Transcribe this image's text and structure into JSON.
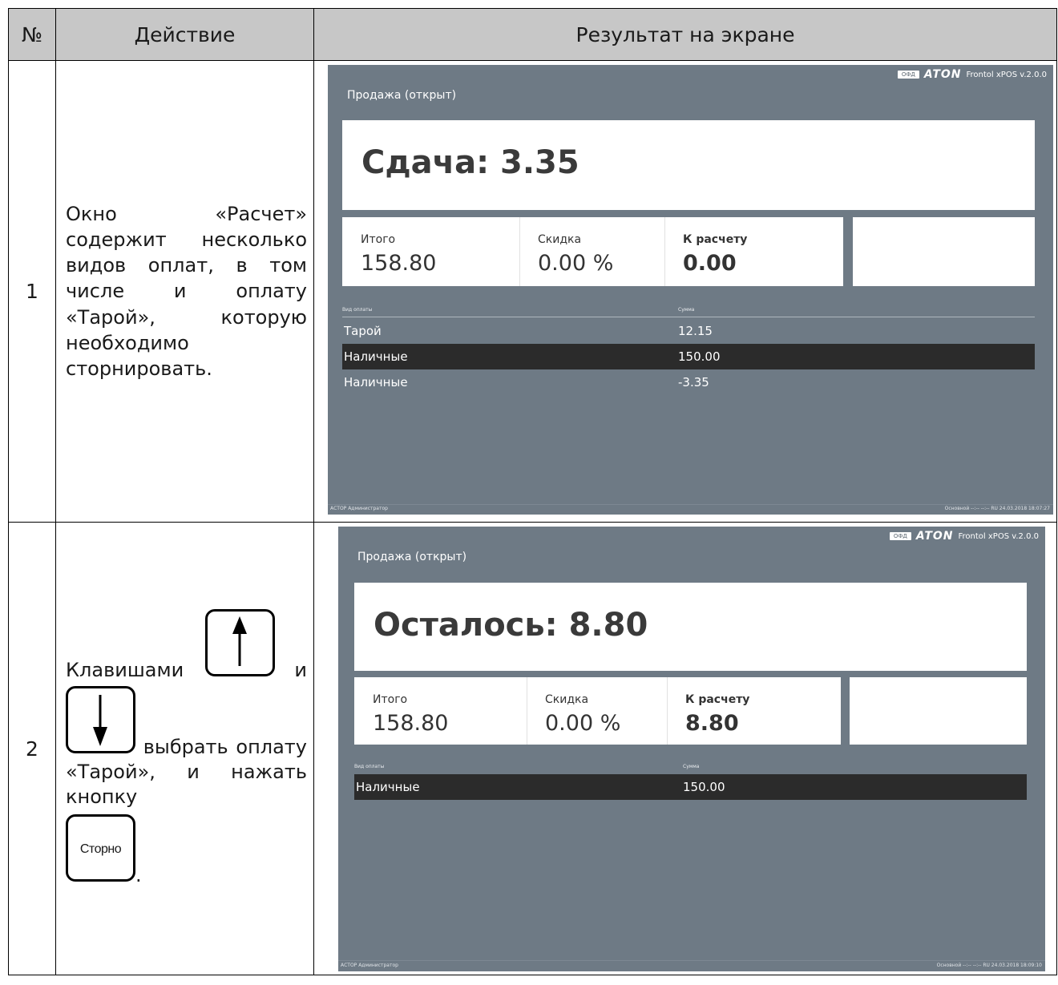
{
  "table": {
    "headers": [
      "№",
      "Действие",
      "Результат на экране"
    ],
    "rows": [
      {
        "num": "1",
        "action": "Окно «Расчет» содержит несколько видов оплат, в том числе и оплату «Тарой», которую необходимо сторнировать."
      },
      {
        "num": "2",
        "action_parts": {
          "p1": "Клавишами",
          "p2": "и",
          "p3": "выбрать оплату «Тарой», и нажать кнопку",
          "p4": "."
        },
        "keys": {
          "up": "arrow-up",
          "down": "arrow-down",
          "storno_label": "Сторно"
        }
      }
    ]
  },
  "screens": [
    {
      "ofd": "ОФД",
      "brand": "ATON",
      "version": "Frontol xPOS v.2.0.0",
      "status": "Продажа (открыт)",
      "big": "Сдача: 3.35",
      "total_label": "Итого",
      "total": "158.80",
      "discount_label": "Скидка",
      "discount": "0.00 %",
      "due_label": "К расчету",
      "due": "0.00",
      "col_type": "Вид оплаты",
      "col_sum": "Сумма",
      "payments": [
        {
          "type": "Тарой",
          "sum": "12.15",
          "selected": false
        },
        {
          "type": "Наличные",
          "sum": "150.00",
          "selected": true
        },
        {
          "type": "Наличные",
          "sum": "-3.35",
          "selected": false
        }
      ],
      "footer_left": "АСТОР  Администратор",
      "footer_right": "Основной      --:--    --:--      RU        24.03.2018 18:07:27"
    },
    {
      "ofd": "ОФД",
      "brand": "ATON",
      "version": "Frontol xPOS v.2.0.0",
      "status": "Продажа (открыт)",
      "big": "Осталось: 8.80",
      "total_label": "Итого",
      "total": "158.80",
      "discount_label": "Скидка",
      "discount": "0.00 %",
      "due_label": "К расчету",
      "due": "8.80",
      "col_type": "Вид оплаты",
      "col_sum": "Сумма",
      "payments": [
        {
          "type": "Наличные",
          "sum": "150.00",
          "selected": true
        }
      ],
      "footer_left": "АСТОР  Администратор",
      "footer_right": "Основной      --:--    --:--      RU        24.03.2018 18:09:10"
    }
  ]
}
